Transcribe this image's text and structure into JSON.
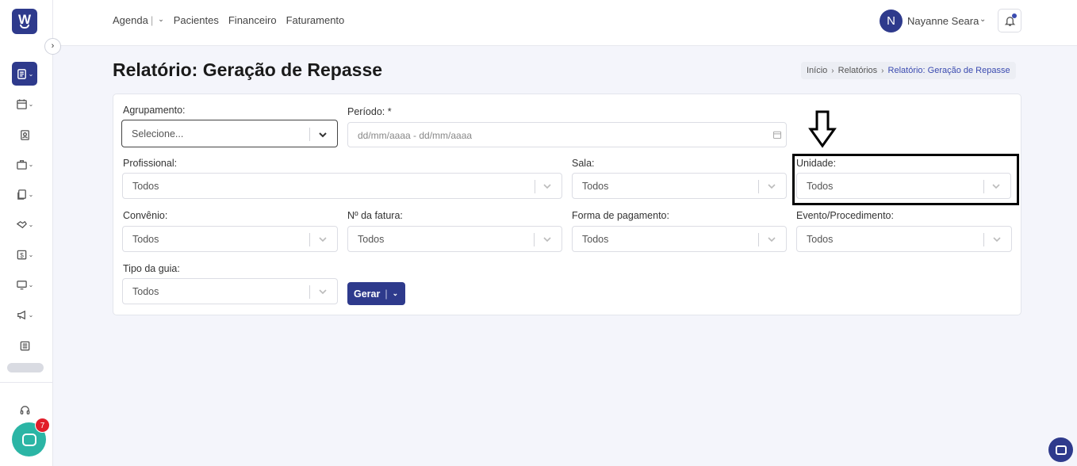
{
  "app": {
    "logo_letter": "W",
    "brand_color": "#2e3a8c",
    "chat_badge_count": "7"
  },
  "topnav": {
    "items": [
      "Agenda",
      "Pacientes",
      "Financeiro",
      "Faturamento"
    ],
    "separator": "|"
  },
  "user": {
    "initial": "N",
    "name": "Nayanne Seara"
  },
  "page": {
    "title": "Relatório: Geração de Repasse"
  },
  "breadcrumb": {
    "items": [
      "Início",
      "Relatórios",
      "Relatório: Geração de Repasse"
    ]
  },
  "form": {
    "agrupamento": {
      "label": "Agrupamento:",
      "value": "Selecione..."
    },
    "periodo": {
      "label": "Período: *",
      "placeholder": "dd/mm/aaaa - dd/mm/aaaa"
    },
    "profissional": {
      "label": "Profissional:",
      "value": "Todos"
    },
    "sala": {
      "label": "Sala:",
      "value": "Todos"
    },
    "unidade": {
      "label": "Unidade:",
      "value": "Todos"
    },
    "convenio": {
      "label": "Convênio:",
      "value": "Todos"
    },
    "fatura": {
      "label": "Nº da fatura:",
      "value": "Todos"
    },
    "pagamento": {
      "label": "Forma de pagamento:",
      "value": "Todos"
    },
    "evento": {
      "label": "Evento/Procedimento:",
      "value": "Todos"
    },
    "tipo_guia": {
      "label": "Tipo da guia:",
      "value": "Todos"
    },
    "gerar_button": "Gerar"
  },
  "sidebar": {
    "icons": [
      "report-icon",
      "calendar-icon",
      "contact-icon",
      "briefcase-icon",
      "files-icon",
      "handshake-icon",
      "dollar-icon",
      "monitor-icon",
      "megaphone-icon",
      "newspaper-icon",
      "headset-icon"
    ]
  }
}
